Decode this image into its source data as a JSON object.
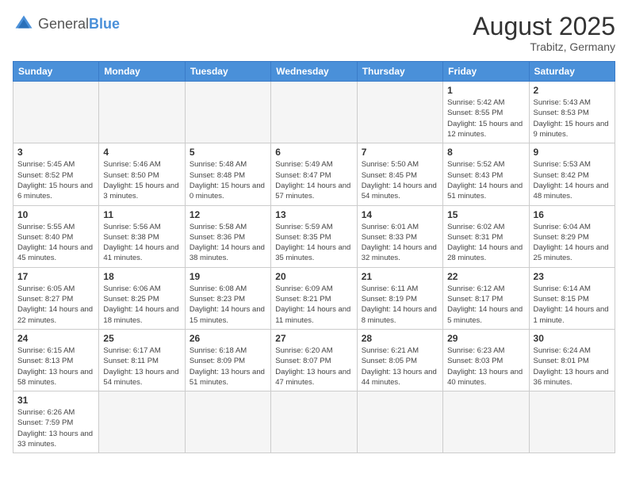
{
  "logo": {
    "general": "General",
    "blue": "Blue"
  },
  "title": {
    "month_year": "August 2025",
    "location": "Trabitz, Germany"
  },
  "weekdays": [
    "Sunday",
    "Monday",
    "Tuesday",
    "Wednesday",
    "Thursday",
    "Friday",
    "Saturday"
  ],
  "weeks": [
    [
      {
        "day": "",
        "empty": true
      },
      {
        "day": "",
        "empty": true
      },
      {
        "day": "",
        "empty": true
      },
      {
        "day": "",
        "empty": true
      },
      {
        "day": "",
        "empty": true
      },
      {
        "day": "1",
        "sunrise": "5:42 AM",
        "sunset": "8:55 PM",
        "daylight": "15 hours and 12 minutes."
      },
      {
        "day": "2",
        "sunrise": "5:43 AM",
        "sunset": "8:53 PM",
        "daylight": "15 hours and 9 minutes."
      }
    ],
    [
      {
        "day": "3",
        "sunrise": "5:45 AM",
        "sunset": "8:52 PM",
        "daylight": "15 hours and 6 minutes."
      },
      {
        "day": "4",
        "sunrise": "5:46 AM",
        "sunset": "8:50 PM",
        "daylight": "15 hours and 3 minutes."
      },
      {
        "day": "5",
        "sunrise": "5:48 AM",
        "sunset": "8:48 PM",
        "daylight": "15 hours and 0 minutes."
      },
      {
        "day": "6",
        "sunrise": "5:49 AM",
        "sunset": "8:47 PM",
        "daylight": "14 hours and 57 minutes."
      },
      {
        "day": "7",
        "sunrise": "5:50 AM",
        "sunset": "8:45 PM",
        "daylight": "14 hours and 54 minutes."
      },
      {
        "day": "8",
        "sunrise": "5:52 AM",
        "sunset": "8:43 PM",
        "daylight": "14 hours and 51 minutes."
      },
      {
        "day": "9",
        "sunrise": "5:53 AM",
        "sunset": "8:42 PM",
        "daylight": "14 hours and 48 minutes."
      }
    ],
    [
      {
        "day": "10",
        "sunrise": "5:55 AM",
        "sunset": "8:40 PM",
        "daylight": "14 hours and 45 minutes."
      },
      {
        "day": "11",
        "sunrise": "5:56 AM",
        "sunset": "8:38 PM",
        "daylight": "14 hours and 41 minutes."
      },
      {
        "day": "12",
        "sunrise": "5:58 AM",
        "sunset": "8:36 PM",
        "daylight": "14 hours and 38 minutes."
      },
      {
        "day": "13",
        "sunrise": "5:59 AM",
        "sunset": "8:35 PM",
        "daylight": "14 hours and 35 minutes."
      },
      {
        "day": "14",
        "sunrise": "6:01 AM",
        "sunset": "8:33 PM",
        "daylight": "14 hours and 32 minutes."
      },
      {
        "day": "15",
        "sunrise": "6:02 AM",
        "sunset": "8:31 PM",
        "daylight": "14 hours and 28 minutes."
      },
      {
        "day": "16",
        "sunrise": "6:04 AM",
        "sunset": "8:29 PM",
        "daylight": "14 hours and 25 minutes."
      }
    ],
    [
      {
        "day": "17",
        "sunrise": "6:05 AM",
        "sunset": "8:27 PM",
        "daylight": "14 hours and 22 minutes."
      },
      {
        "day": "18",
        "sunrise": "6:06 AM",
        "sunset": "8:25 PM",
        "daylight": "14 hours and 18 minutes."
      },
      {
        "day": "19",
        "sunrise": "6:08 AM",
        "sunset": "8:23 PM",
        "daylight": "14 hours and 15 minutes."
      },
      {
        "day": "20",
        "sunrise": "6:09 AM",
        "sunset": "8:21 PM",
        "daylight": "14 hours and 11 minutes."
      },
      {
        "day": "21",
        "sunrise": "6:11 AM",
        "sunset": "8:19 PM",
        "daylight": "14 hours and 8 minutes."
      },
      {
        "day": "22",
        "sunrise": "6:12 AM",
        "sunset": "8:17 PM",
        "daylight": "14 hours and 5 minutes."
      },
      {
        "day": "23",
        "sunrise": "6:14 AM",
        "sunset": "8:15 PM",
        "daylight": "14 hours and 1 minute."
      }
    ],
    [
      {
        "day": "24",
        "sunrise": "6:15 AM",
        "sunset": "8:13 PM",
        "daylight": "13 hours and 58 minutes."
      },
      {
        "day": "25",
        "sunrise": "6:17 AM",
        "sunset": "8:11 PM",
        "daylight": "13 hours and 54 minutes."
      },
      {
        "day": "26",
        "sunrise": "6:18 AM",
        "sunset": "8:09 PM",
        "daylight": "13 hours and 51 minutes."
      },
      {
        "day": "27",
        "sunrise": "6:20 AM",
        "sunset": "8:07 PM",
        "daylight": "13 hours and 47 minutes."
      },
      {
        "day": "28",
        "sunrise": "6:21 AM",
        "sunset": "8:05 PM",
        "daylight": "13 hours and 44 minutes."
      },
      {
        "day": "29",
        "sunrise": "6:23 AM",
        "sunset": "8:03 PM",
        "daylight": "13 hours and 40 minutes."
      },
      {
        "day": "30",
        "sunrise": "6:24 AM",
        "sunset": "8:01 PM",
        "daylight": "13 hours and 36 minutes."
      }
    ],
    [
      {
        "day": "31",
        "sunrise": "6:26 AM",
        "sunset": "7:59 PM",
        "daylight": "13 hours and 33 minutes.",
        "last": true
      },
      {
        "day": "",
        "empty": true,
        "last": true
      },
      {
        "day": "",
        "empty": true,
        "last": true
      },
      {
        "day": "",
        "empty": true,
        "last": true
      },
      {
        "day": "",
        "empty": true,
        "last": true
      },
      {
        "day": "",
        "empty": true,
        "last": true
      },
      {
        "day": "",
        "empty": true,
        "last": true
      }
    ]
  ]
}
